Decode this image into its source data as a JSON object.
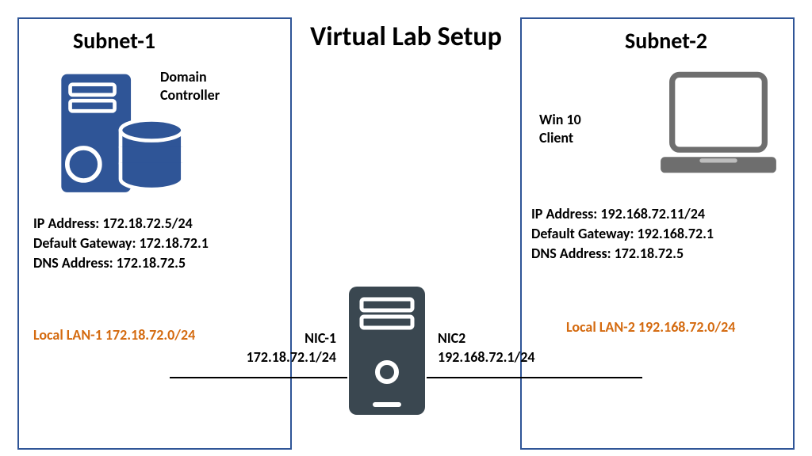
{
  "title": "Virtual Lab Setup",
  "subnet1": {
    "title": "Subnet-1",
    "icon": "server-with-database-icon",
    "device_label_l1": "Domain",
    "device_label_l2": "Controller",
    "ip": "IP Address: 172.18.72.5/24",
    "gw": "Default Gateway: 172.18.72.1",
    "dns": "DNS Address: 172.18.72.5",
    "lan": "Local LAN-1 172.18.72.0/24"
  },
  "subnet2": {
    "title": "Subnet-2",
    "icon": "laptop-icon",
    "device_label_l1": "Win 10",
    "device_label_l2": "Client",
    "ip": "IP Address: 192.168.72.11/24",
    "gw": "Default Gateway: 192.168.72.1",
    "dns": "DNS Address: 172.18.72.5",
    "lan": "Local LAN-2 192.168.72.0/24"
  },
  "router": {
    "icon": "pc-tower-icon",
    "nic1_label": "NIC-1",
    "nic1_ip": "172.18.72.1/24",
    "nic2_label": "NIC2",
    "nic2_ip": "192.168.72.1/24"
  },
  "colors": {
    "box_border": "#2f5597",
    "server_fill": "#2f5597",
    "router_fill": "#3a4750",
    "laptop_stroke": "#6e6e6e",
    "lan_text": "#d46a0f"
  }
}
